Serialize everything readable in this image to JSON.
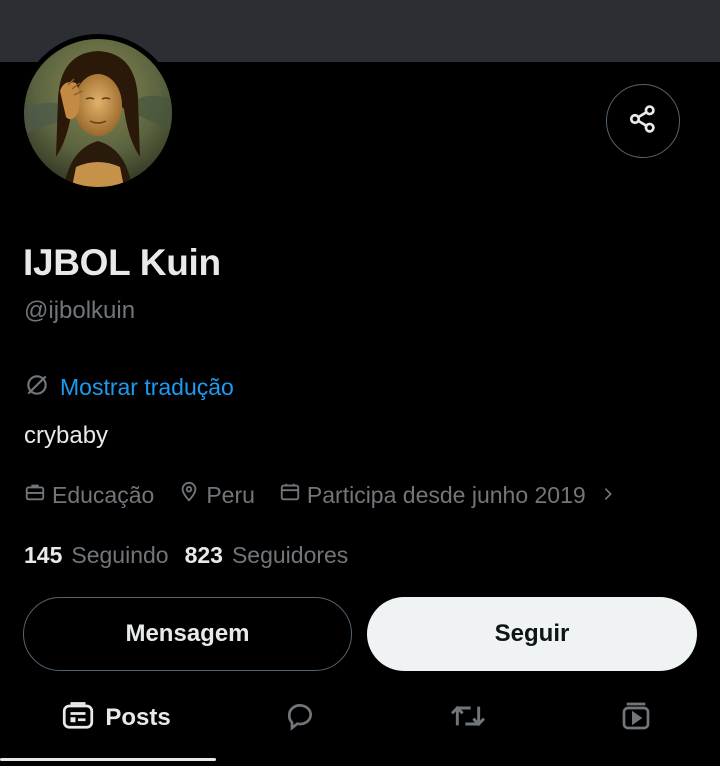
{
  "profile": {
    "display_name": "IJBOL Kuin",
    "handle": "@ijbolkuin",
    "translate_label": "Mostrar tradução",
    "bio": "crybaby",
    "category": "Educação",
    "location": "Peru",
    "joined": "Participa desde junho 2019",
    "following_count": "145",
    "following_label": "Seguindo",
    "followers_count": "823",
    "followers_label": "Seguidores"
  },
  "actions": {
    "message_label": "Mensagem",
    "follow_label": "Seguir"
  },
  "tabs": [
    {
      "label": "Posts",
      "icon": "posts-icon",
      "active": true
    },
    {
      "label": "",
      "icon": "replies-icon",
      "active": false
    },
    {
      "label": "",
      "icon": "reposts-icon",
      "active": false
    },
    {
      "label": "",
      "icon": "media-icon",
      "active": false
    }
  ],
  "colors": {
    "background": "#000000",
    "banner": "#2b2f33",
    "text_primary": "#e7e9ea",
    "text_secondary": "#71767b",
    "accent_link": "#1d9bf0",
    "follow_button_bg": "#eff3f4"
  }
}
